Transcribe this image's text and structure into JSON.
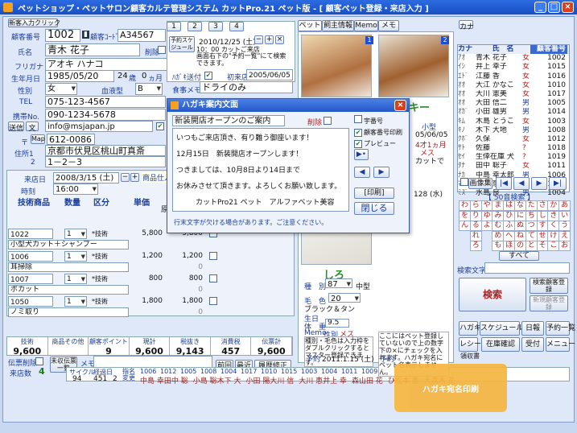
{
  "window": {
    "title": "ペットショップ・ペットサロン顧客カルテ管理システム カットPro.21 ペット版 - [ 顧客ペット登録・来店入力 ]"
  },
  "customer": {
    "new_entry_button": "新客入力クリック",
    "id_label": "顧客番号",
    "id": "1002",
    "code_label": "顧客ｺｰﾄﾞ",
    "code": "A34567",
    "name_label": "氏名",
    "name": "青木 花子",
    "delete_label": "削除",
    "kana_label": "フリガナ",
    "kana": "アオキ ハナコ",
    "dob_label": "生年月日",
    "dob": "1985/05/20",
    "age": "24",
    "age_unit": "歳",
    "months": "0",
    "months_unit": "ヵ月",
    "gender_label": "性別",
    "gender": "女",
    "blood_label": "血液型",
    "blood": "B",
    "tel_label": "TEL",
    "tel": "075-123-4567",
    "mobile_label": "携帯No.",
    "mobile": "090-1234-5678",
    "send_label": "送信",
    "text_label": "文",
    "email": "info@msjapan.jp",
    "zip_label": "〒",
    "map_label": "Map",
    "zip": "612-0086",
    "addr1_label": "住所1",
    "addr1": "京都市伏見区桃山町真斎",
    "addr2_label": "2",
    "addr2": "1－2－3",
    "postcard_label": "ﾊｶﾞｷ送付",
    "firstvisit_label": "初来店",
    "firstvisit": "2005/06/05",
    "food_label": "食事メモ",
    "food": "ドライのみ"
  },
  "visit": {
    "visit_label": "来店日",
    "visit_date": "2008/3/15 (土)",
    "time_label": "時刻",
    "time": "16:00",
    "goods_label": "商品仕入",
    "headers": [
      "技術商品",
      "数量",
      "区分",
      "単価"
    ],
    "rows": [
      {
        "code": "1022",
        "qty": "1",
        "kind": "*技術",
        "price": "5,800",
        "total": "5,800",
        "sub": "",
        "name": "小型犬カット＋シャンプー"
      },
      {
        "code": "1006",
        "qty": "1",
        "kind": "*技術",
        "price": "1,200",
        "total": "1,200",
        "sub": "0",
        "name": "耳掃除"
      },
      {
        "code": "1007",
        "qty": "1",
        "kind": "*技術",
        "price": "800",
        "total": "800",
        "sub": "0",
        "name": "ボカット"
      },
      {
        "code": "1050",
        "qty": "1",
        "kind": "*技術",
        "price": "1,800",
        "total": "1,800",
        "sub": "0",
        "name": "ノミ取り"
      }
    ],
    "sub_values": [
      "1,200",
      "800",
      "1,800"
    ],
    "orig_label": "原"
  },
  "totals": {
    "labels": [
      "技術",
      "商品その他",
      "顧客ポイント",
      "現計",
      "税抜き",
      "消費税",
      "伝票計"
    ],
    "values": [
      "9,600",
      "",
      "9",
      "9,600",
      "9,143",
      "457",
      "9,600"
    ]
  },
  "footer": {
    "slip_label": "伝票削除",
    "uncollected_label": "未収伝票一覧",
    "memo_label": "メモ",
    "visits_label": "来店数",
    "visits": "4",
    "prev_btn": "前回",
    "recent_btn": "最近",
    "history_btn": "履歴修正",
    "cycle_label": "サイクル",
    "cycle_value": "94",
    "elapsed_label": "経過日",
    "elapsed": "451",
    "pages": "2",
    "nav_label": "指名変更"
  },
  "reservation": {
    "tabs": [
      "1",
      "2",
      "3",
      "4"
    ],
    "reserve_btn": "予約スケジュール",
    "date": "2010/12/25 (土)",
    "time_text": "10：00 カットご来店",
    "note": "画面右下の\"予約一覧\"にて検索できます。"
  },
  "pet_tabs": [
    "ペット",
    "飼主情報",
    "Memo",
    "メモ"
  ],
  "pets": [
    {
      "name": "モカ",
      "no": "1"
    },
    {
      "name": "ラッキー",
      "no": "2"
    },
    {
      "name": "しろ",
      "no": "3"
    }
  ],
  "pet_detail": {
    "species_label": "種　別",
    "species": "中型",
    "breed1": "87",
    "breed2": "20",
    "color_label": "毛　色",
    "color": "ブラック＆タン",
    "birth_label": "生日",
    "weight_label": "体　重",
    "weight": "9.5",
    "memo_label": "Memo",
    "gender_label": "性別",
    "gender": "メス",
    "memo": "種別・毛色は入力枠をダブルクリックするとマスター登録できます。",
    "memo2": "ここにはペット登録していないので上の数字下の×にチェックを入れます。ハガキ宛名にペット名表示しません。",
    "reserve_label": "予約",
    "reserve_date": "2011.1.15 (土)",
    "date2": "05/06/05",
    "age2": "4才1ヵ月",
    "gender2": "メス",
    "cut_note": "カットで",
    "small_label": "小型",
    "date3": "128 (水)"
  },
  "dialog": {
    "title": "ハガキ案内文面",
    "subject": "新装開店オープンのご案内",
    "delete_label": "削除",
    "lines": [
      "いつもご来店頂き、有り難う御座います！",
      "12月15日　新装開店オープンします！",
      "つきましては、10月8日より14日まで",
      "お休みさせて頂きます。よろしくお願い致します。",
      "カットPro21 ペット　アルファベット美容"
    ],
    "options": [
      "宇番号",
      "顧客番号印刷",
      "プレビュー"
    ],
    "print_btn": "[印刷]",
    "close_btn": "閉じる",
    "footer_note": "行末文字が欠ける場合があります。ご注意ください。"
  },
  "namelist": {
    "kana_label": "カナ",
    "name_label": "氏　名",
    "id_label": "顧客番号",
    "rows": [
      {
        "k": "ｱｵ",
        "n": "青木 花子",
        "g": "女",
        "id": "1002"
      },
      {
        "k": "ｲｼ",
        "n": "井上 幸子",
        "g": "女",
        "id": "1015"
      },
      {
        "k": "ｴﾄﾞ",
        "n": "江藤 香",
        "g": "女",
        "id": "1016"
      },
      {
        "k": "ｵｵ",
        "n": "大江 かなこ",
        "g": "女",
        "id": "1010"
      },
      {
        "k": "ｵｵ",
        "n": "大川 憲美",
        "g": "女",
        "id": "1017"
      },
      {
        "k": "ｵｵ",
        "n": "大田 信二",
        "g": "男",
        "id": "1005"
      },
      {
        "k": "ｵｶﾞ",
        "n": "小田 雄男",
        "g": "男",
        "id": "1014"
      },
      {
        "k": "ｷﾑ",
        "n": "木島 とうこ",
        "g": "女",
        "id": "1003"
      },
      {
        "k": "ｷﾉ",
        "n": "木下 大地",
        "g": "男",
        "id": "1008"
      },
      {
        "k": "ｸﾎﾞ",
        "n": "久保",
        "g": "女",
        "id": "1012"
      },
      {
        "k": "ｻﾄ",
        "n": "佐藤",
        "g": "?",
        "id": "1018"
      },
      {
        "k": "ｾｲ",
        "n": "生倖在庫 犬",
        "g": "?",
        "id": "1019"
      },
      {
        "k": "ﾀﾅ",
        "n": "田中 聡子",
        "g": "女",
        "id": "1011"
      },
      {
        "k": "ﾅｶ",
        "n": "中島 幸太郎",
        "g": "男",
        "id": "1006"
      },
      {
        "k": "ﾏﾂ",
        "n": "松本 恵紀",
        "g": "女",
        "id": "1009"
      },
      {
        "k": "ﾐｽﾞ",
        "n": "水島 良",
        "g": "男",
        "id": "1004"
      }
    ],
    "image_btn": "画像集",
    "kana_search": "【 50音検索 】",
    "kana_grid": [
      "わ",
      "ら",
      "や",
      "ま",
      "は",
      "な",
      "た",
      "さ",
      "か",
      "あ",
      "を",
      "り",
      "ゆ",
      "み",
      "ひ",
      "に",
      "ち",
      "し",
      "き",
      "い",
      "ん",
      "る",
      "よ",
      "む",
      "ふ",
      "ぬ",
      "つ",
      "す",
      "く",
      "う",
      "",
      "れ",
      "",
      "め",
      "へ",
      "ね",
      "て",
      "せ",
      "け",
      "え",
      "",
      "ろ",
      "",
      "も",
      "ほ",
      "の",
      "と",
      "そ",
      "こ",
      "お"
    ],
    "all_btn": "すべて",
    "search_label": "検索文字",
    "search_btn": "検索",
    "new_reg_btn": "検索顧客登録",
    "new_btn2": "新規顧客登録"
  },
  "actions": [
    "ハガキ",
    "スケジュール",
    "日報",
    "予約一覧",
    "レシート",
    "在庫確認",
    "受付",
    "メニュー"
  ],
  "receipt_sub": "領収書",
  "callout": "ハガキ宛名印刷",
  "bottom_strip": {
    "ids": [
      "1006",
      "1012",
      "1005",
      "1008",
      "1004",
      "1017",
      "1010",
      "1015",
      "1003",
      "1004",
      "1011",
      "1009",
      "1002"
    ],
    "names": [
      "中島 幸田中 聡",
      "小島 聡木下 大",
      "小田 陽大川 信",
      "大川 恵井上 幸",
      "森山田 花",
      "ひ松本 恵",
      "大森木 花"
    ]
  }
}
